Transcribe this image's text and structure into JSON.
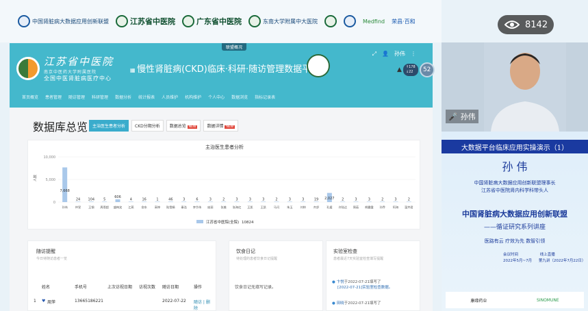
{
  "viewer_count": "8142",
  "top_logos": [
    "中国肾脏病大数据应用创新联盟",
    "江苏省中医院",
    "广东省中医院",
    "东南大学附属中大医院",
    "Medfind",
    "荣昌·百和"
  ],
  "system": {
    "tag": "联盟概况",
    "hospital_name": "江苏省中医院",
    "hospital_sub": "南京中医药大学附属医院",
    "hospital_slogan": "全国中医肾脏病医疗中心",
    "platform_title": "慢性肾脏病(CKD)临床·科研·随访管理数据平台",
    "user_name": "孙伟",
    "speed_up": "178",
    "speed_down": "22",
    "cpu": "52",
    "nav": [
      "首页概览",
      "患者管理",
      "随访管理",
      "科研管理",
      "数据分析",
      "统计报表",
      "人员维护",
      "机构维护",
      "个人中心",
      "数据浏览",
      "指标记录表"
    ]
  },
  "dashboard": {
    "title": "数据库总览",
    "tabs": [
      {
        "label": "主治医生患者分析",
        "active": true,
        "new": false
      },
      {
        "label": "CKD分期分析",
        "active": false,
        "new": false
      },
      {
        "label": "数据总览",
        "active": false,
        "new": true
      },
      {
        "label": "数据详情",
        "active": false,
        "new": true
      }
    ],
    "new_badge": "NEW"
  },
  "chart_data": {
    "type": "bar",
    "title": "主治医生患者分析",
    "ylabel": "人数",
    "yticks": [
      "10,000",
      "5,000",
      "0"
    ],
    "ylim": [
      0,
      10000
    ],
    "categories": [
      "孙伟",
      "仲昱",
      "王钢",
      "周恩超",
      "盛梅笑",
      "江燕",
      "俞东",
      "高坤",
      "陆雪娟",
      "秦浩",
      "李华伟",
      "庞丽",
      "张美",
      "张海红",
      "王凯",
      "王凯",
      "马闪",
      "朱玉",
      "刘帅",
      "齐舒",
      "孔媛",
      "许陆达",
      "周茹",
      "胡露霞",
      "孙乔",
      "阿海",
      "温井君"
    ],
    "values": [
      7668,
      24,
      104,
      5,
      606,
      4,
      16,
      1,
      46,
      3,
      6,
      3,
      2,
      3,
      3,
      3,
      2,
      3,
      3,
      19,
      2027,
      2,
      3,
      3,
      2,
      3,
      2
    ],
    "labels": [
      "7,668",
      "24",
      "104",
      "5",
      "606",
      "4",
      "16",
      "1",
      "46",
      "3",
      "6",
      "3",
      "2",
      "3",
      "3",
      "3",
      "2",
      "3",
      "3",
      "19",
      "2,027",
      "2",
      "3",
      "3",
      "2",
      "3",
      "2"
    ],
    "legend": "江苏省中医院(全院)",
    "legend_total": "10824"
  },
  "followup": {
    "title": "随访提醒",
    "subtitle": "今日待随访患者一览",
    "columns": [
      "姓名",
      "手机号",
      "上次访视日期",
      "访视次数",
      "随访日期",
      "操作"
    ],
    "row": {
      "index": "1",
      "name": "周萍",
      "phone": "13665186221",
      "date": "2022-07-22",
      "actions": "随访 | 删除"
    }
  },
  "diet": {
    "title": "饮食日记",
    "subtitle": "待处理的患者饮食日记提醒",
    "empty": "饮食日记无填写记录。"
  },
  "lab": {
    "title": "实验室检查",
    "subtitle": "患者最近7天实验室检查填写提醒",
    "items": [
      {
        "user": "卞悦",
        "text": "于2022-07-21填写了",
        "detail": "[2022-07-21]实验室检查数据。"
      },
      {
        "user": "田晓",
        "text": "于2022-07-21填写了",
        "detail": ""
      }
    ]
  },
  "speaker": {
    "name_tag": "孙伟"
  },
  "banner": {
    "heading_small": "中国肾脏病大数据应用创新联盟",
    "series": "——循证研究系列讲座",
    "demo_title": "大数据平台临床应用实操演示（1）",
    "speaker": "孙 伟",
    "role1": "中国肾脏病大数据应用创新联盟理事长",
    "role2": "江苏省中医院肾内科学科带头人",
    "big_title": "中国肾脏病大数据应用创新联盟",
    "big_sub": "——循证研究系列讲座",
    "slogan": "医路有云  疗效为先  数智引领",
    "meeting_label": "会议时间",
    "meeting_date": "2022年5月~7月",
    "phase_label": "线上直播",
    "phase": "第九讲（2022年7月22日）",
    "sponsors": [
      "康缘药业",
      "SINOMUNE"
    ]
  }
}
